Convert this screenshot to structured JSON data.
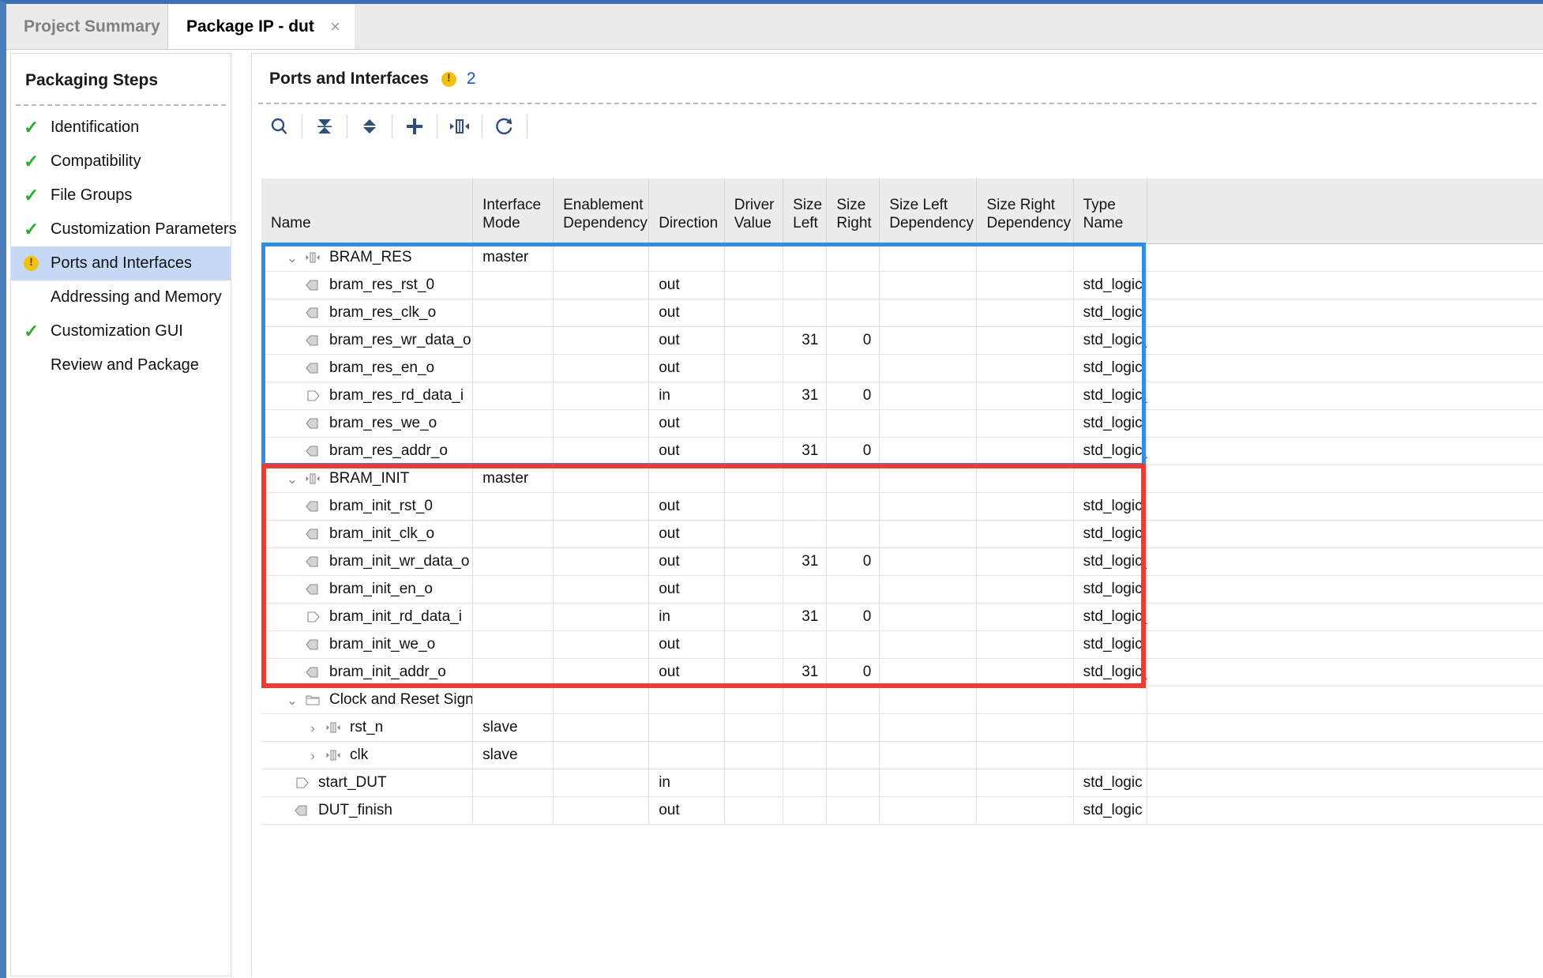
{
  "window": {
    "accent_border": "#4a7ebb"
  },
  "tabs": [
    {
      "label": "Project Summary",
      "close": "×",
      "active": false
    },
    {
      "label": "Package IP - dut",
      "close": "×",
      "active": true
    }
  ],
  "sidebar": {
    "title": "Packaging Steps",
    "items": [
      {
        "label": "Identification",
        "icon": "check-icon",
        "state": "done"
      },
      {
        "label": "Compatibility",
        "icon": "check-icon",
        "state": "done"
      },
      {
        "label": "File Groups",
        "icon": "check-icon",
        "state": "done"
      },
      {
        "label": "Customization Parameters",
        "icon": "check-icon",
        "state": "done"
      },
      {
        "label": "Ports and Interfaces",
        "icon": "warning-icon",
        "state": "selected"
      },
      {
        "label": "Addressing and Memory",
        "icon": "none",
        "state": "none"
      },
      {
        "label": "Customization GUI",
        "icon": "check-icon",
        "state": "done"
      },
      {
        "label": "Review and Package",
        "icon": "none",
        "state": "none"
      }
    ]
  },
  "main": {
    "title": "Ports and Interfaces",
    "warning_icon": "warning-icon",
    "warning_count": "2",
    "toolbar": [
      {
        "name": "search-icon",
        "title": "Search"
      },
      {
        "name": "collapse-all-icon",
        "title": "Collapse All"
      },
      {
        "name": "expand-all-icon",
        "title": "Expand All"
      },
      {
        "name": "add-icon",
        "title": "Add Interface"
      },
      {
        "name": "auto-infer-icon",
        "title": "Auto Infer Interface"
      },
      {
        "name": "refresh-icon",
        "title": "Refresh"
      }
    ],
    "columns": [
      "Name",
      "Interface\nMode",
      "Enablement\nDependency",
      "Direction",
      "Driver\nValue",
      "Size\nLeft",
      "Size\nRight",
      "Size Left\nDependency",
      "Size Right\nDependency",
      "Type\nName",
      ""
    ],
    "rows": [
      {
        "name": "BRAM_RES",
        "level": 0,
        "icon": "interface-icon",
        "twisty": "expanded",
        "mode": "master",
        "enablement": "",
        "direction": "",
        "driver": "",
        "size_left": "",
        "size_right": "",
        "size_left_dep": "",
        "size_right_dep": "",
        "type": ""
      },
      {
        "name": "bram_res_rst_0",
        "level": 1,
        "icon": "output-port-icon",
        "twisty": "",
        "mode": "",
        "enablement": "",
        "direction": "out",
        "driver": "",
        "size_left": "",
        "size_right": "",
        "size_left_dep": "",
        "size_right_dep": "",
        "type": "std_logic"
      },
      {
        "name": "bram_res_clk_o",
        "level": 1,
        "icon": "output-port-icon",
        "twisty": "",
        "mode": "",
        "enablement": "",
        "direction": "out",
        "driver": "",
        "size_left": "",
        "size_right": "",
        "size_left_dep": "",
        "size_right_dep": "",
        "type": "std_logic"
      },
      {
        "name": "bram_res_wr_data_o",
        "level": 1,
        "icon": "output-port-icon",
        "twisty": "",
        "mode": "",
        "enablement": "",
        "direction": "out",
        "driver": "",
        "size_left": "31",
        "size_right": "0",
        "size_left_dep": "",
        "size_right_dep": "",
        "type": "std_logic_v"
      },
      {
        "name": "bram_res_en_o",
        "level": 1,
        "icon": "output-port-icon",
        "twisty": "",
        "mode": "",
        "enablement": "",
        "direction": "out",
        "driver": "",
        "size_left": "",
        "size_right": "",
        "size_left_dep": "",
        "size_right_dep": "",
        "type": "std_logic"
      },
      {
        "name": "bram_res_rd_data_i",
        "level": 1,
        "icon": "input-port-icon",
        "twisty": "",
        "mode": "",
        "enablement": "",
        "direction": "in",
        "driver": "",
        "size_left": "31",
        "size_right": "0",
        "size_left_dep": "",
        "size_right_dep": "",
        "type": "std_logic_v"
      },
      {
        "name": "bram_res_we_o",
        "level": 1,
        "icon": "output-port-icon",
        "twisty": "",
        "mode": "",
        "enablement": "",
        "direction": "out",
        "driver": "",
        "size_left": "",
        "size_right": "",
        "size_left_dep": "",
        "size_right_dep": "",
        "type": "std_logic"
      },
      {
        "name": "bram_res_addr_o",
        "level": 1,
        "icon": "output-port-icon",
        "twisty": "",
        "mode": "",
        "enablement": "",
        "direction": "out",
        "driver": "",
        "size_left": "31",
        "size_right": "0",
        "size_left_dep": "",
        "size_right_dep": "",
        "type": "std_logic_v"
      },
      {
        "name": "BRAM_INIT",
        "level": 0,
        "icon": "interface-icon",
        "twisty": "expanded",
        "mode": "master",
        "enablement": "",
        "direction": "",
        "driver": "",
        "size_left": "",
        "size_right": "",
        "size_left_dep": "",
        "size_right_dep": "",
        "type": ""
      },
      {
        "name": "bram_init_rst_0",
        "level": 1,
        "icon": "output-port-icon",
        "twisty": "",
        "mode": "",
        "enablement": "",
        "direction": "out",
        "driver": "",
        "size_left": "",
        "size_right": "",
        "size_left_dep": "",
        "size_right_dep": "",
        "type": "std_logic"
      },
      {
        "name": "bram_init_clk_o",
        "level": 1,
        "icon": "output-port-icon",
        "twisty": "",
        "mode": "",
        "enablement": "",
        "direction": "out",
        "driver": "",
        "size_left": "",
        "size_right": "",
        "size_left_dep": "",
        "size_right_dep": "",
        "type": "std_logic"
      },
      {
        "name": "bram_init_wr_data_o",
        "level": 1,
        "icon": "output-port-icon",
        "twisty": "",
        "mode": "",
        "enablement": "",
        "direction": "out",
        "driver": "",
        "size_left": "31",
        "size_right": "0",
        "size_left_dep": "",
        "size_right_dep": "",
        "type": "std_logic_v"
      },
      {
        "name": "bram_init_en_o",
        "level": 1,
        "icon": "output-port-icon",
        "twisty": "",
        "mode": "",
        "enablement": "",
        "direction": "out",
        "driver": "",
        "size_left": "",
        "size_right": "",
        "size_left_dep": "",
        "size_right_dep": "",
        "type": "std_logic"
      },
      {
        "name": "bram_init_rd_data_i",
        "level": 1,
        "icon": "input-port-icon",
        "twisty": "",
        "mode": "",
        "enablement": "",
        "direction": "in",
        "driver": "",
        "size_left": "31",
        "size_right": "0",
        "size_left_dep": "",
        "size_right_dep": "",
        "type": "std_logic_v"
      },
      {
        "name": "bram_init_we_o",
        "level": 1,
        "icon": "output-port-icon",
        "twisty": "",
        "mode": "",
        "enablement": "",
        "direction": "out",
        "driver": "",
        "size_left": "",
        "size_right": "",
        "size_left_dep": "",
        "size_right_dep": "",
        "type": "std_logic"
      },
      {
        "name": "bram_init_addr_o",
        "level": 1,
        "icon": "output-port-icon",
        "twisty": "",
        "mode": "",
        "enablement": "",
        "direction": "out",
        "driver": "",
        "size_left": "31",
        "size_right": "0",
        "size_left_dep": "",
        "size_right_dep": "",
        "type": "std_logic_v"
      },
      {
        "name": "Clock and Reset Signals",
        "level": 0,
        "icon": "folder-icon",
        "twisty": "expanded",
        "mode": "",
        "enablement": "",
        "direction": "",
        "driver": "",
        "size_left": "",
        "size_right": "",
        "size_left_dep": "",
        "size_right_dep": "",
        "type": ""
      },
      {
        "name": "rst_n",
        "level": 1,
        "icon": "interface-icon",
        "twisty": "collapsed",
        "mode": "slave",
        "enablement": "",
        "direction": "",
        "driver": "",
        "size_left": "",
        "size_right": "",
        "size_left_dep": "",
        "size_right_dep": "",
        "type": ""
      },
      {
        "name": "clk",
        "level": 1,
        "icon": "interface-icon",
        "twisty": "collapsed",
        "mode": "slave",
        "enablement": "",
        "direction": "",
        "driver": "",
        "size_left": "",
        "size_right": "",
        "size_left_dep": "",
        "size_right_dep": "",
        "type": ""
      },
      {
        "name": "start_DUT",
        "level": 2,
        "icon": "input-port-icon",
        "twisty": "",
        "mode": "",
        "enablement": "",
        "direction": "in",
        "driver": "",
        "size_left": "",
        "size_right": "",
        "size_left_dep": "",
        "size_right_dep": "",
        "type": "std_logic"
      },
      {
        "name": "DUT_finish",
        "level": 2,
        "icon": "output-port-icon",
        "twisty": "",
        "mode": "",
        "enablement": "",
        "direction": "out",
        "driver": "",
        "size_left": "",
        "size_right": "",
        "size_left_dep": "",
        "size_right_dep": "",
        "type": "std_logic"
      }
    ],
    "highlights": [
      {
        "name": "bram-res-highlight",
        "color": "#2f8de4",
        "first_row": 0,
        "last_row": 7
      },
      {
        "name": "bram-init-highlight",
        "color": "#f23b30",
        "first_row": 8,
        "last_row": 15
      }
    ]
  }
}
